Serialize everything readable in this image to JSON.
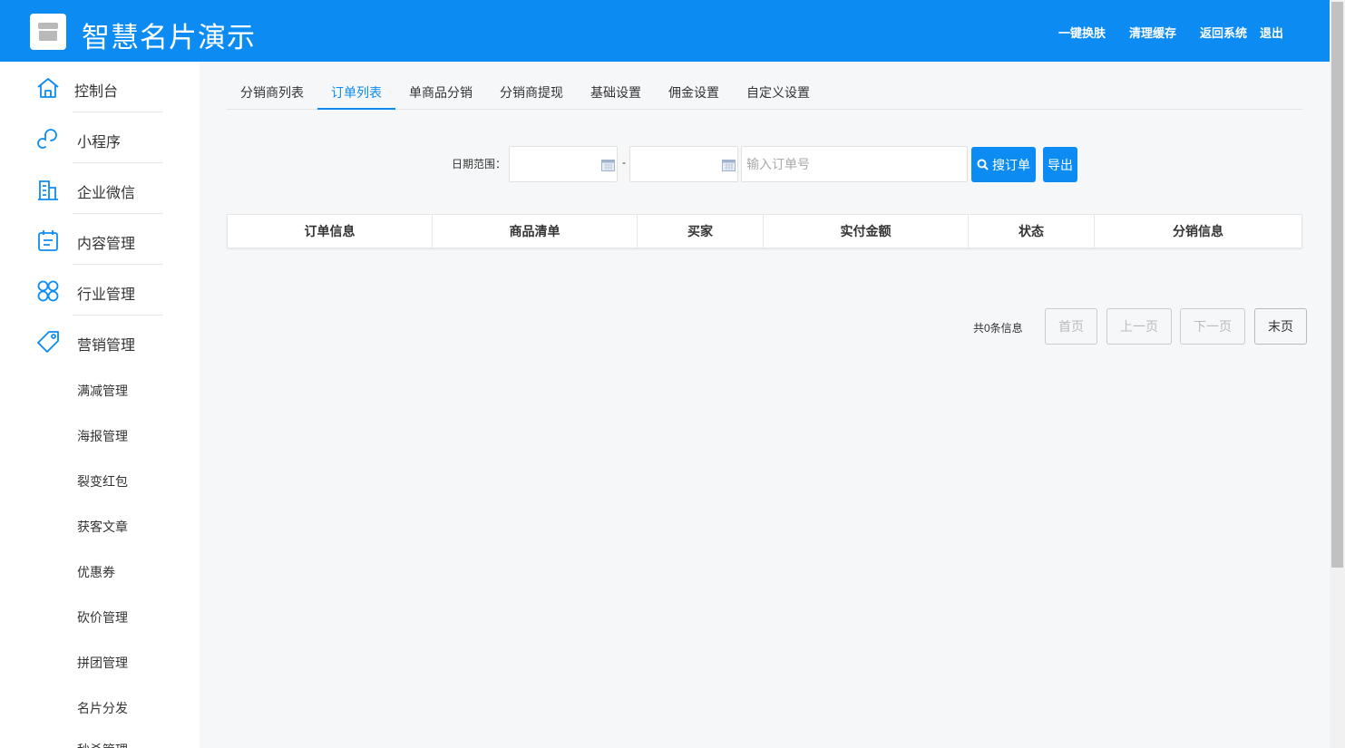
{
  "header": {
    "title": "智慧名片演示",
    "links": [
      "一键换肤",
      "清理缓存",
      "返回系统",
      "退出"
    ]
  },
  "sidebar": {
    "items": [
      {
        "label": "控制台",
        "icon": "home-icon"
      },
      {
        "label": "小程序",
        "icon": "link-icon"
      },
      {
        "label": "企业微信",
        "icon": "building-icon"
      },
      {
        "label": "内容管理",
        "icon": "calendar-icon"
      },
      {
        "label": "行业管理",
        "icon": "clover-icon"
      },
      {
        "label": "营销管理",
        "icon": "tag-icon"
      }
    ],
    "subitems": [
      "满减管理",
      "海报管理",
      "裂变红包",
      "获客文章",
      "优惠券",
      "砍价管理",
      "拼团管理",
      "名片分发",
      "秒杀管理"
    ]
  },
  "tabs": [
    "分销商列表",
    "订单列表",
    "单商品分销",
    "分销商提现",
    "基础设置",
    "佣金设置",
    "自定义设置"
  ],
  "active_tab": "订单列表",
  "search": {
    "date_label": "日期范围：",
    "dash": "-",
    "order_placeholder": "输入订单号",
    "search_button": "搜订单",
    "export_button": "导出"
  },
  "table": {
    "columns": [
      "订单信息",
      "商品清单",
      "买家",
      "实付金额",
      "状态",
      "分销信息"
    ],
    "rows": []
  },
  "pagination": {
    "total": "共0条信息",
    "first": "首页",
    "prev": "上一页",
    "next": "下一页",
    "last": "末页"
  },
  "colors": {
    "accent": "#0c8cf2",
    "background": "#f6f7f9"
  }
}
